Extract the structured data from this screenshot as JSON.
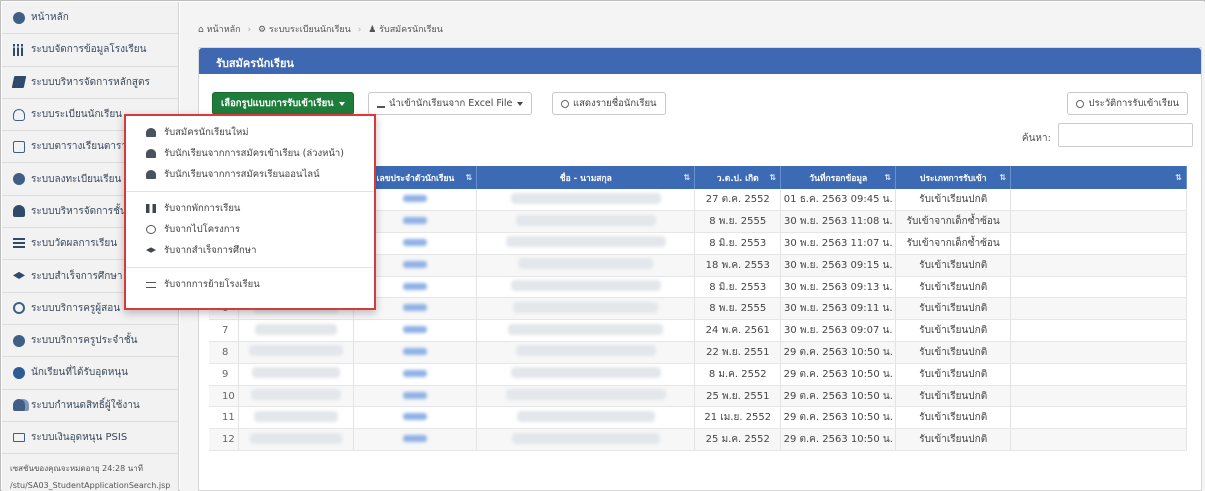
{
  "sidebar": {
    "items": [
      {
        "label": "หน้าหลัก",
        "icon": "dashboard-icon"
      },
      {
        "label": "ระบบจัดการข้อมูลโรงเรียน",
        "icon": "school-building-icon"
      },
      {
        "label": "ระบบบริหารจัดการหลักสูตร",
        "icon": "book-icon"
      },
      {
        "label": "ระบบระเบียนนักเรียน",
        "icon": "user-icon"
      },
      {
        "label": "ระบบตารางเรียนตารางสอน",
        "icon": "calendar-icon"
      },
      {
        "label": "ระบบลงทะเบียนเรียน",
        "icon": "registered-icon"
      },
      {
        "label": "ระบบบริหารจัดการชั้นเรียน",
        "icon": "person-icon"
      },
      {
        "label": "ระบบวัดผลการเรียน",
        "icon": "list-icon"
      },
      {
        "label": "ระบบสำเร็จการศึกษา",
        "icon": "graduation-cap-icon"
      },
      {
        "label": "ระบบบริการครูผู้สอน",
        "icon": "user-circle-icon"
      },
      {
        "label": "ระบบบริการครูประจำชั้น",
        "icon": "teacher-icon"
      },
      {
        "label": "นักเรียนที่ได้รับอุดหนุน",
        "icon": "check-circle-icon"
      },
      {
        "label": "ระบบกำหนดสิทธิ์ผู้ใช้งาน",
        "icon": "users-icon"
      },
      {
        "label": "ระบบเงินอุดหนุน PSIS",
        "icon": "money-icon"
      }
    ],
    "session_text": "เซสชันของคุณจะหมดอายุ 24:28 นาที",
    "path_text": "/stu/SA03_StudentApplicationSearch.jsp"
  },
  "breadcrumb": {
    "home": "หน้าหลัก",
    "section": "ระบบระเบียนนักเรียน",
    "current": "รับสมัครนักเรียน"
  },
  "panel": {
    "title": "รับสมัครนักเรียน"
  },
  "toolbar": {
    "admission_type_label": "เลือกรูปแบบการรับเข้าเรียน",
    "import_excel_label": "นำเข้านักเรียนจาก Excel File",
    "show_names_label": "แสดงรายชื่อนักเรียน",
    "history_label": "ประวัติการรับเข้าเรียน"
  },
  "menu": {
    "group1": [
      "รับสมัครนักเรียนใหม่",
      "รับนักเรียนจากการสมัครเข้าเรียน (ล่วงหน้า)",
      "รับนักเรียนจากการสมัครเรียนออนไลน์"
    ],
    "group2": [
      "รับจากพักการเรียน",
      "รับจากไปโครงการ",
      "รับจากสำเร็จการศึกษา"
    ],
    "group3": [
      "รับจากการย้ายโรงเรียน"
    ]
  },
  "search": {
    "label": "ค้นหา:"
  },
  "table": {
    "headers": [
      "",
      "",
      "เลขประจำตัวนักเรียน",
      "ชื่อ - นามสกุล",
      "ว.ด.ป. เกิด",
      "วันที่กรอกข้อมูล",
      "ประเภทการรับเข้า",
      ""
    ],
    "rows": [
      {
        "num": "1",
        "dob": "27 ต.ค. 2552",
        "entered": "01 ธ.ค. 2563 09:45 น.",
        "type": "รับเข้าเรียนปกติ"
      },
      {
        "num": "2",
        "dob": "8 พ.ย. 2555",
        "entered": "30 พ.ย. 2563 11:08 น.",
        "type": "รับเข้าจากเด็กซ้ำซ้อน"
      },
      {
        "num": "3",
        "dob": "8 มิ.ย. 2553",
        "entered": "30 พ.ย. 2563 11:07 น.",
        "type": "รับเข้าจากเด็กซ้ำซ้อน"
      },
      {
        "num": "4",
        "dob": "18 พ.ค. 2553",
        "entered": "30 พ.ย. 2563 09:15 น.",
        "type": "รับเข้าเรียนปกติ"
      },
      {
        "num": "5",
        "dob": "8 มิ.ย. 2553",
        "entered": "30 พ.ย. 2563 09:13 น.",
        "type": "รับเข้าเรียนปกติ"
      },
      {
        "num": "6",
        "dob": "8 พ.ย. 2555",
        "entered": "30 พ.ย. 2563 09:11 น.",
        "type": "รับเข้าเรียนปกติ"
      },
      {
        "num": "7",
        "dob": "24 พ.ค. 2561",
        "entered": "30 พ.ย. 2563 09:07 น.",
        "type": "รับเข้าเรียนปกติ"
      },
      {
        "num": "8",
        "dob": "22 พ.ย. 2551",
        "entered": "29 ต.ค. 2563 10:50 น.",
        "type": "รับเข้าเรียนปกติ"
      },
      {
        "num": "9",
        "dob": "8 ม.ค. 2552",
        "entered": "29 ต.ค. 2563 10:50 น.",
        "type": "รับเข้าเรียนปกติ"
      },
      {
        "num": "10",
        "dob": "25 พ.ย. 2551",
        "entered": "29 ต.ค. 2563 10:50 น.",
        "type": "รับเข้าเรียนปกติ"
      },
      {
        "num": "11",
        "dob": "21 เม.ย. 2552",
        "entered": "29 ต.ค. 2563 10:50 น.",
        "type": "รับเข้าเรียนปกติ"
      },
      {
        "num": "12",
        "dob": "25 ม.ค. 2552",
        "entered": "29 ต.ค. 2563 10:50 น.",
        "type": "รับเข้าเรียนปกติ"
      }
    ]
  },
  "colors": {
    "header_blue": "#3f68b3",
    "button_green": "#1e7d3a",
    "menu_border_red": "#d83a3a"
  }
}
